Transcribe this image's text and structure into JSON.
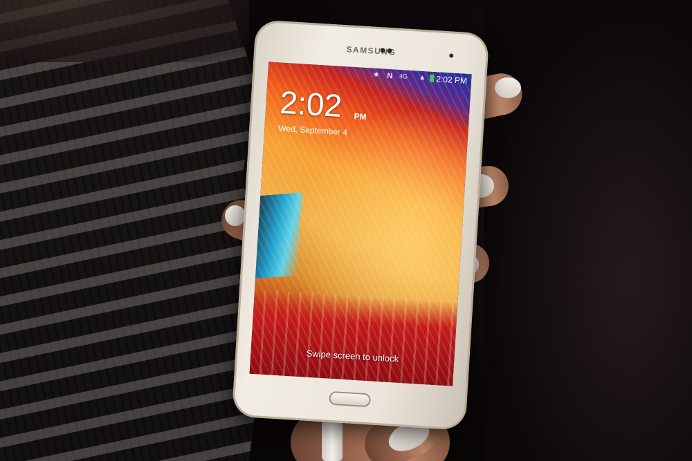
{
  "scene": {
    "description_tag": "phone-lockscreen-photo"
  },
  "phone": {
    "brand": "SAMSUNG",
    "status_bar": {
      "network": "4G",
      "time": "2:02 PM",
      "icons": [
        "bluetooth-icon",
        "nfc-icon",
        "battery-icon"
      ],
      "battery_color": "#3fcf4a"
    },
    "lockscreen": {
      "clock": "2:02",
      "ampm": "PM",
      "date": "Wed, September 4",
      "unlock_hint": "Swipe screen to unlock"
    }
  },
  "colors": {
    "phone_body": "#f2ede4",
    "wallpaper_primary": "#f7a033",
    "wallpaper_red": "#c41a1a",
    "wallpaper_blue": "#18a7d8"
  }
}
